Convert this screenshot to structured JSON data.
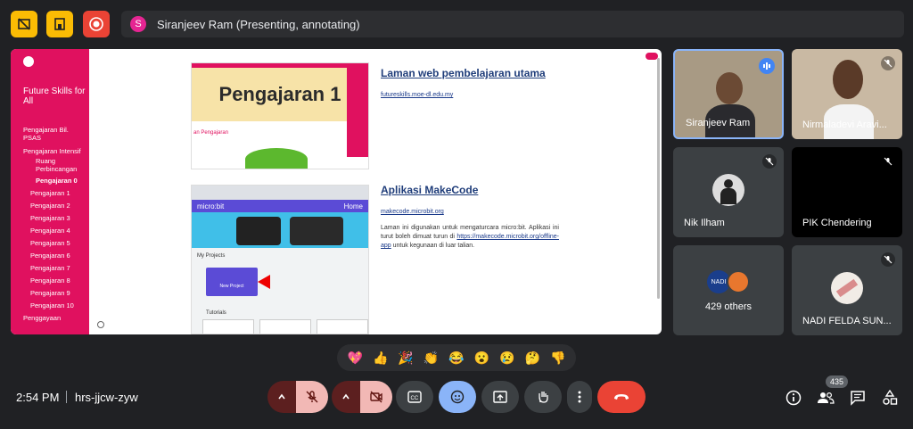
{
  "top": {
    "presenter_initial": "S",
    "presenter_text": "Siranjeev Ram (Presenting, annotating)"
  },
  "doc": {
    "sidebar_title": "Future Skills for All",
    "sidebar_items": [
      "Pengajaran Bil. PSAS",
      "Pengajaran Intensif",
      "Ruang Perbincangan",
      "Pengajaran 0",
      "Pengajaran 1",
      "Pengajaran 2",
      "Pengajaran 3",
      "Pengajaran 4",
      "Pengajaran 5",
      "Pengajaran 6",
      "Pengajaran 7",
      "Pengajaran 8",
      "Pengajaran 9",
      "Pengajaran 10",
      "Penggayaan"
    ],
    "banner": "Pengajaran 1",
    "banner_sub": "an Pengajaran",
    "microbit_brand": "micro:bit",
    "home": "Home",
    "my_projects": "My Projects",
    "new_project": "New Project",
    "tutorials": "Tutorials",
    "heading1": "Laman web pembelajaran utama",
    "link1": "futureskills.moe-dl.edu.my",
    "heading2": "Aplikasi MakeCode",
    "link2": "makecode.microbit.org",
    "para_start": "Laman ini digunakan untuk mengaturcara micro:bit. Aplikasi ini turut boleh dimuat turun di ",
    "para_link": "https://makecode.microbit.org/offline-app",
    "para_end": " untuk kegunaan di luar talian."
  },
  "tiles": [
    {
      "name": "Siranjeev Ram"
    },
    {
      "name": "Nirmaladevi Aravi..."
    },
    {
      "name": "Nik Ilham"
    },
    {
      "name": "PIK Chendering"
    },
    {
      "name": "429 others"
    },
    {
      "name": "NADI FELDA SUN..."
    }
  ],
  "reactions": [
    "💖",
    "👍",
    "🎉",
    "👏",
    "😂",
    "😮",
    "😢",
    "🤔",
    "👎"
  ],
  "bottom": {
    "time": "2:54 PM",
    "meeting_code": "hrs-jjcw-zyw",
    "participant_count": "435"
  },
  "colors": {
    "accent_pink": "#e0115f",
    "leave_red": "#ea4335",
    "active_blue": "#8ab4f8"
  }
}
